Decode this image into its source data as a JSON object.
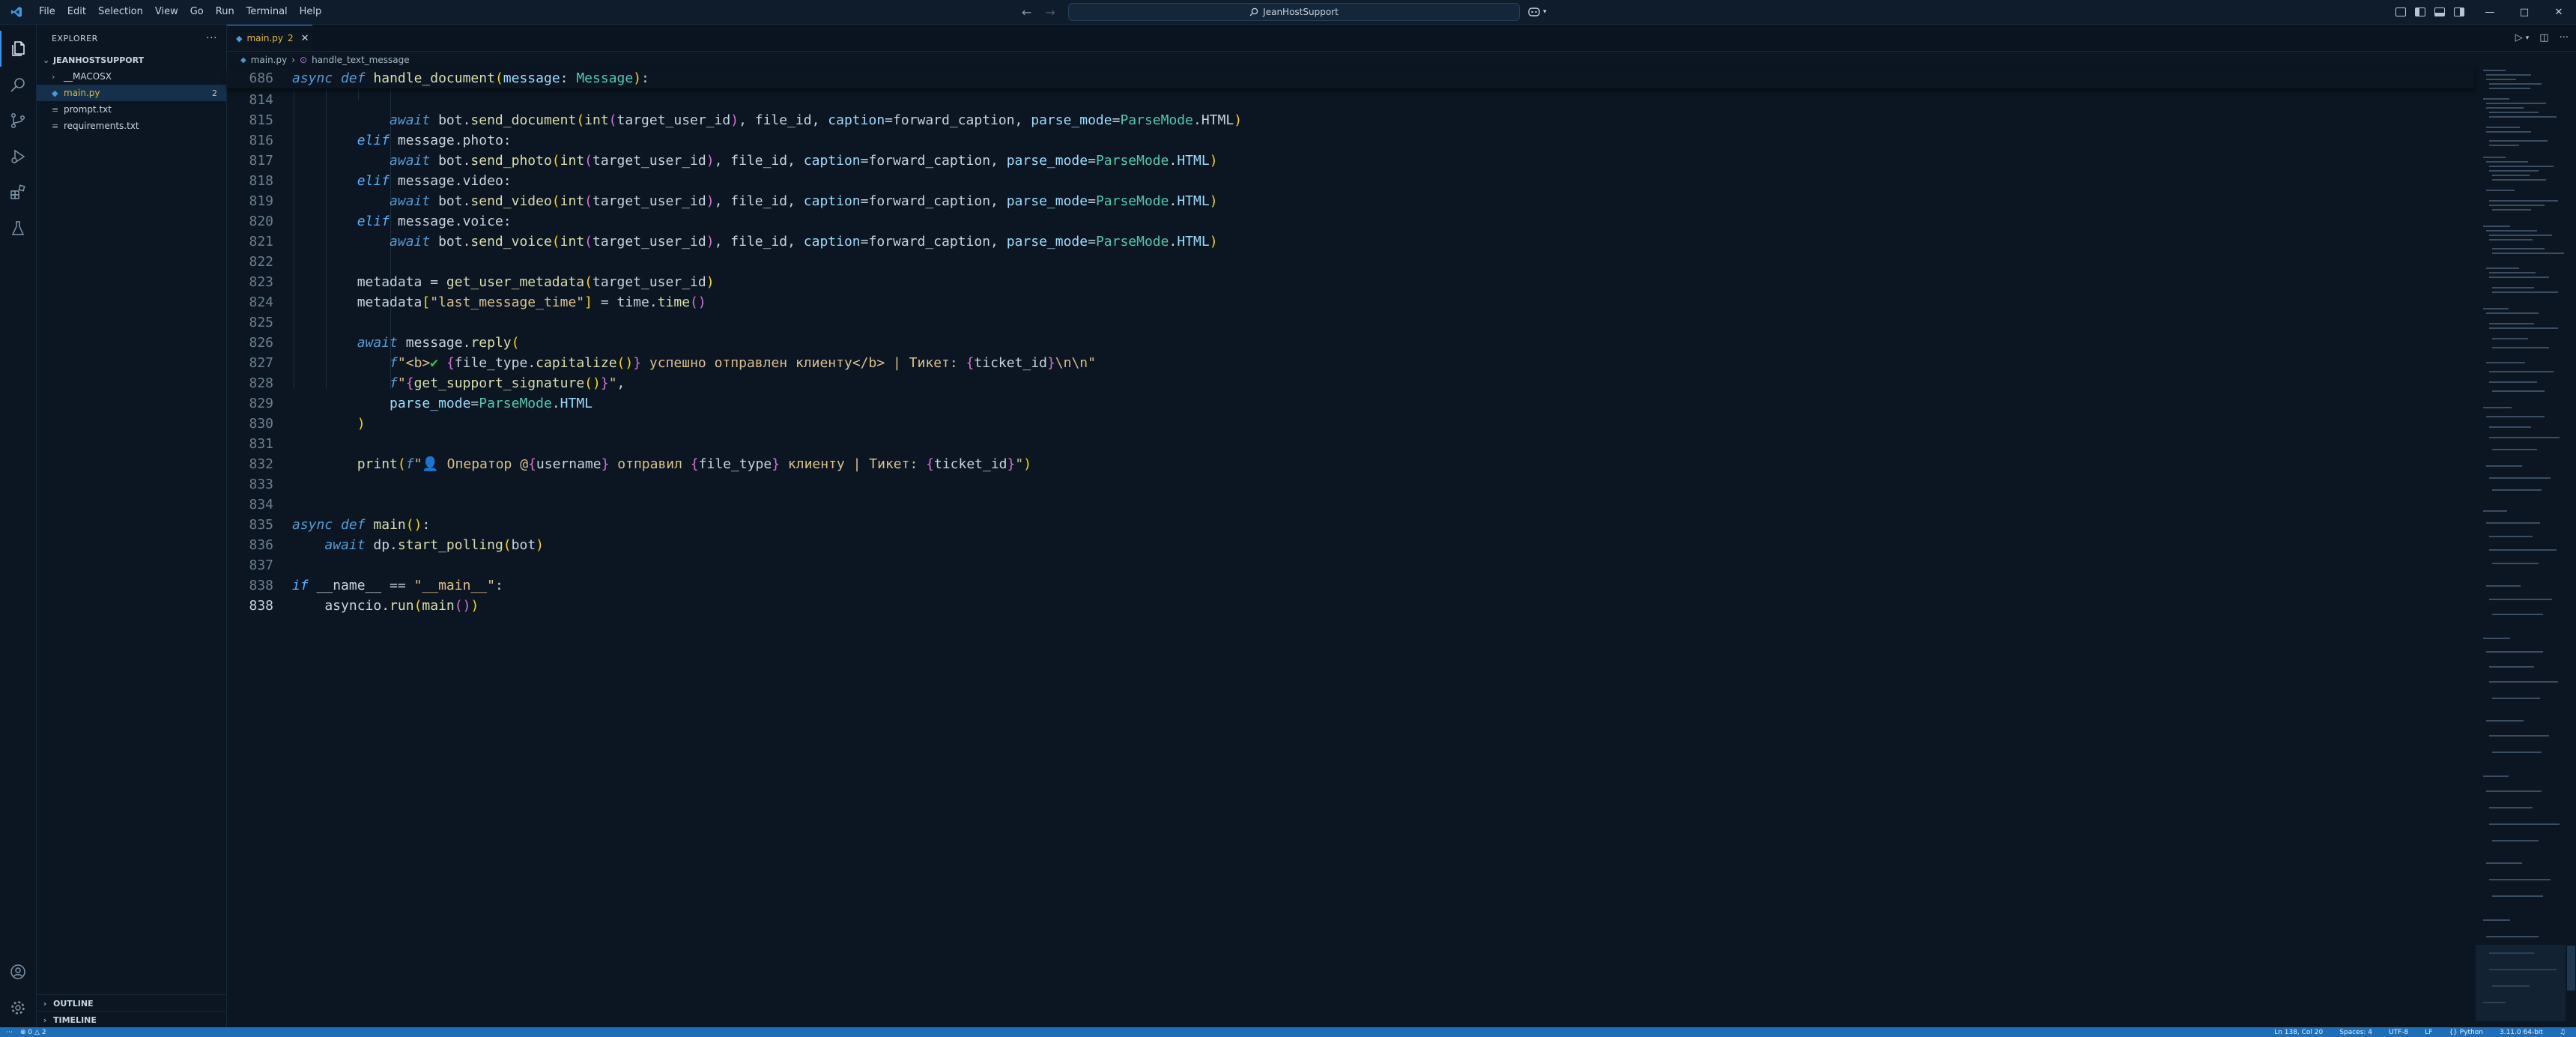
{
  "menu": [
    "File",
    "Edit",
    "Selection",
    "View",
    "Go",
    "Run",
    "Terminal",
    "Help"
  ],
  "search": {
    "text": "JeanHostSupport"
  },
  "sidebar": {
    "title": "EXPLORER",
    "project": "JEANHOSTSUPPORT",
    "items": [
      {
        "label": "__MACOSX",
        "type": "folder"
      },
      {
        "label": "main.py",
        "type": "python",
        "badge": "2"
      },
      {
        "label": "prompt.txt",
        "type": "text"
      },
      {
        "label": "requirements.txt",
        "type": "text"
      }
    ],
    "outline": "OUTLINE",
    "timeline": "TIMELINE"
  },
  "tab": {
    "label": "main.py",
    "count": "2"
  },
  "breadcrumb": {
    "file": "main.py",
    "symbol": "handle_text_message"
  },
  "sticky": {
    "number": "686"
  },
  "code_lines": [
    {
      "n": "814"
    },
    {
      "n": "815"
    },
    {
      "n": "816"
    },
    {
      "n": "817"
    },
    {
      "n": "818"
    },
    {
      "n": "819"
    },
    {
      "n": "820"
    },
    {
      "n": "821"
    },
    {
      "n": "822"
    },
    {
      "n": "823"
    },
    {
      "n": "824"
    },
    {
      "n": "825"
    },
    {
      "n": "826"
    },
    {
      "n": "827"
    },
    {
      "n": "828"
    },
    {
      "n": "829"
    },
    {
      "n": "830"
    },
    {
      "n": "831"
    },
    {
      "n": "832"
    },
    {
      "n": "833"
    },
    {
      "n": "834"
    },
    {
      "n": "835"
    },
    {
      "n": "836"
    },
    {
      "n": "837"
    },
    {
      "n": "838"
    }
  ],
  "status": {
    "problems": "0",
    "warnings": "2",
    "position": "Ln 138, Col 20",
    "spaces": "Spaces: 4",
    "encoding": "UTF-8",
    "eol": "LF",
    "language": "Python",
    "interpreter": "3.11.0 64-bit"
  },
  "colors": {
    "accent": "#3b8eea",
    "statusbar": "#1e6fb8",
    "background": "#0b1622"
  }
}
